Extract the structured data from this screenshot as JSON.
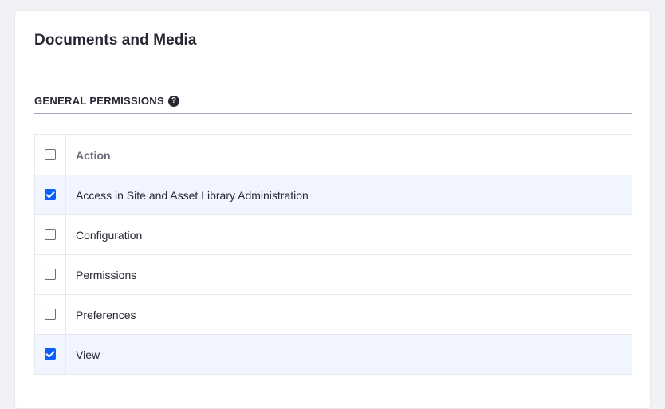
{
  "panel": {
    "title": "Documents and Media",
    "section_label": "GENERAL PERMISSIONS",
    "help_symbol": "?"
  },
  "table": {
    "header": {
      "label": "Action",
      "checked": false
    },
    "rows": [
      {
        "label": "Access in Site and Asset Library Administration",
        "checked": true
      },
      {
        "label": "Configuration",
        "checked": false
      },
      {
        "label": "Permissions",
        "checked": false
      },
      {
        "label": "Preferences",
        "checked": false
      },
      {
        "label": "View",
        "checked": true
      }
    ]
  },
  "colors": {
    "accent": "#0b5fff",
    "checked_row_bg": "#f0f5ff",
    "page_bg": "#f1f2f5"
  }
}
